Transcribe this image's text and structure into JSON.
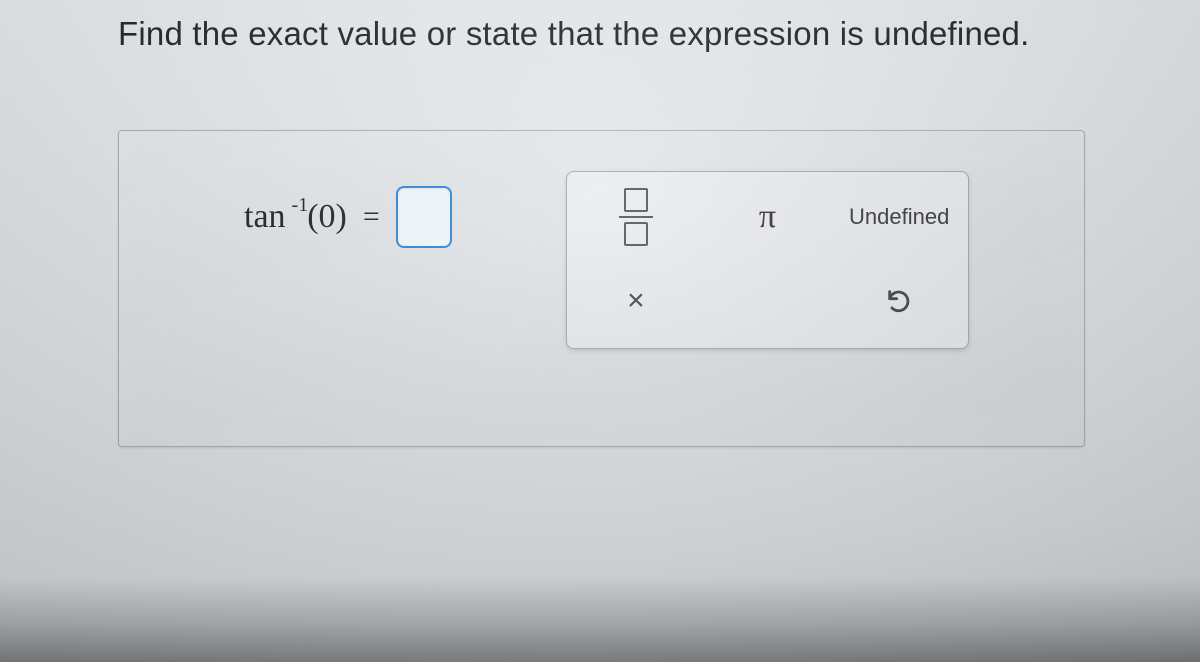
{
  "question": "Find the exact value or state that the expression is undefined.",
  "expression": {
    "function": "tan",
    "superscript": "-1",
    "argument": "(0)",
    "equals": "=",
    "input_value": ""
  },
  "toolbox": {
    "fraction_label": "fraction",
    "pi_label": "π",
    "undefined_label": "Undefined",
    "clear_label": "×",
    "reset_label": "reset"
  }
}
